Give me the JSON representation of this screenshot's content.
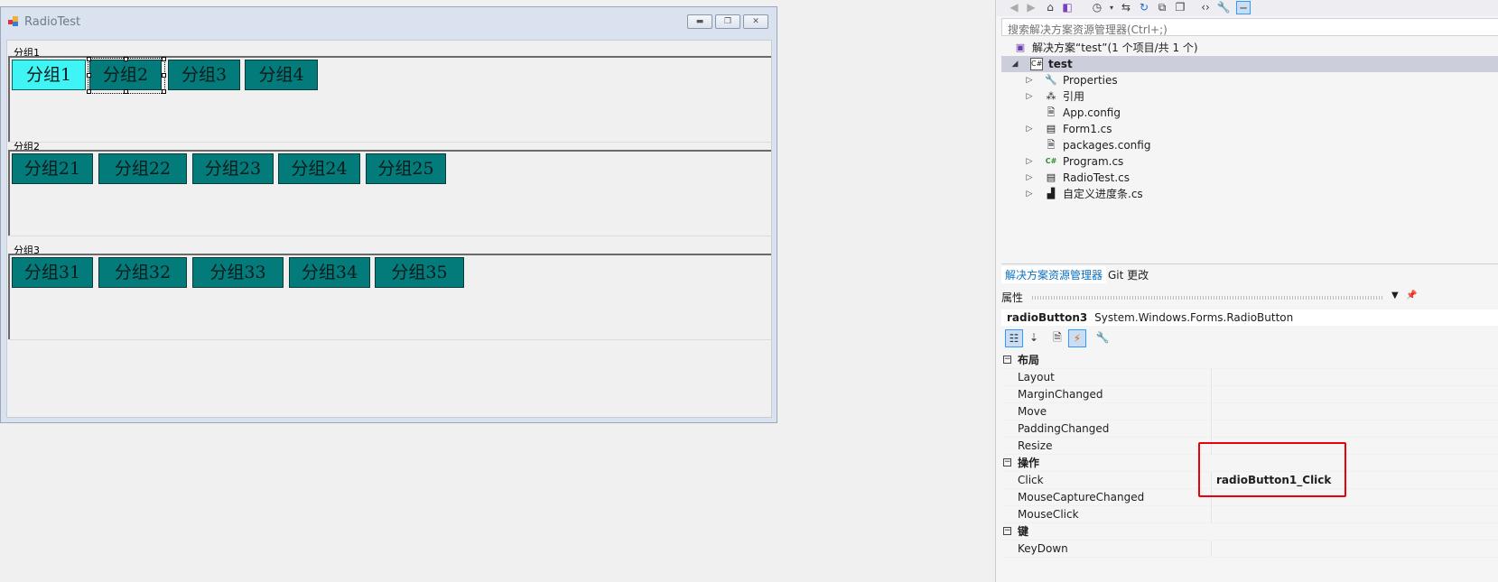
{
  "form_window": {
    "title": "RadioTest",
    "groups": [
      {
        "label": "分组1",
        "buttons": [
          "分组1",
          "分组2",
          "分组3",
          "分组4"
        ]
      },
      {
        "label": "分组2",
        "buttons": [
          "分组21",
          "分组22",
          "分组23",
          "分组24",
          "分组25"
        ]
      },
      {
        "label": "分组3",
        "buttons": [
          "分组31",
          "分组32",
          "分组33",
          "分组34",
          "分组35"
        ]
      }
    ],
    "checked_button": "分组1",
    "selected_button": "分组2",
    "colors": {
      "button_bg": "#047b7b",
      "checked_bg": "#3ff4f4"
    }
  },
  "solution_explorer": {
    "search_placeholder": "搜索解决方案资源管理器(Ctrl+;)",
    "solution_label": "解决方案“test”(1 个项目/共 1 个)",
    "project": "test",
    "items": [
      "Properties",
      "引用",
      "App.config",
      "Form1.cs",
      "packages.config",
      "Program.cs",
      "RadioTest.cs",
      "自定义进度条.cs"
    ],
    "tabs": [
      "解决方案资源管理器",
      "Git 更改"
    ]
  },
  "properties": {
    "header": "属性",
    "object_name": "radioButton3",
    "object_type": "System.Windows.Forms.RadioButton",
    "categories": [
      {
        "name": "布局",
        "props": [
          "Layout",
          "MarginChanged",
          "Move",
          "PaddingChanged",
          "Resize"
        ]
      },
      {
        "name": "操作",
        "props": [
          "Click",
          "MouseCaptureChanged",
          "MouseClick"
        ]
      },
      {
        "name": "键",
        "props": [
          "KeyDown"
        ]
      }
    ],
    "click_value": "radioButton1_Click"
  }
}
